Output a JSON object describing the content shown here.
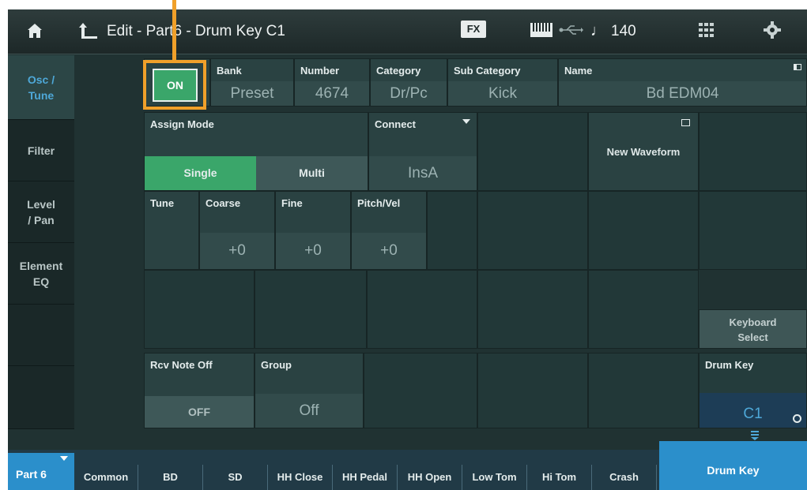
{
  "header": {
    "title": "Edit - Part6 - Drum Key C1",
    "fx_label": "FX",
    "tempo_symbol": "♩",
    "tempo": "140"
  },
  "left_tabs": [
    {
      "label": "Osc /\nTune",
      "active": true
    },
    {
      "label": "Filter",
      "active": false
    },
    {
      "label": "Level\n/ Pan",
      "active": false
    },
    {
      "label": "Element\nEQ",
      "active": false
    },
    {
      "label": "",
      "active": false
    },
    {
      "label": "",
      "active": false
    }
  ],
  "element_switch": {
    "value": "ON"
  },
  "info_row": {
    "bank": {
      "label": "Bank",
      "value": "Preset"
    },
    "number": {
      "label": "Number",
      "value": "4674"
    },
    "category": {
      "label": "Category",
      "value": "Dr/Pc"
    },
    "sub_category": {
      "label": "Sub Category",
      "value": "Kick"
    },
    "name": {
      "label": "Name",
      "value": "Bd EDM04"
    }
  },
  "assign_mode": {
    "label": "Assign Mode",
    "options": [
      "Single",
      "Multi"
    ],
    "selected": "Single"
  },
  "connect": {
    "label": "Connect",
    "value": "InsA"
  },
  "new_waveform": {
    "label": "New Waveform"
  },
  "tune": {
    "label": "Tune",
    "coarse": {
      "label": "Coarse",
      "value": "+0"
    },
    "fine": {
      "label": "Fine",
      "value": "+0"
    },
    "pitch_vel": {
      "label": "Pitch/Vel",
      "value": "+0"
    }
  },
  "rcv_note_off": {
    "label": "Rcv Note Off",
    "value": "OFF"
  },
  "group": {
    "label": "Group",
    "value": "Off"
  },
  "keyboard_select": {
    "label": "Keyboard\nSelect"
  },
  "drum_key": {
    "label": "Drum Key",
    "value": "C1"
  },
  "bottom_tabs": {
    "part": "Part 6",
    "items": [
      "Common",
      "BD",
      "SD",
      "HH Close",
      "HH Pedal",
      "HH Open",
      "Low Tom",
      "Hi Tom",
      "Crash"
    ],
    "drum_key": "Drum Key"
  },
  "colors": {
    "accent": "#2b8fcb",
    "on": "#3aa66a",
    "highlight": "#f0a02a",
    "background": "#203232"
  }
}
